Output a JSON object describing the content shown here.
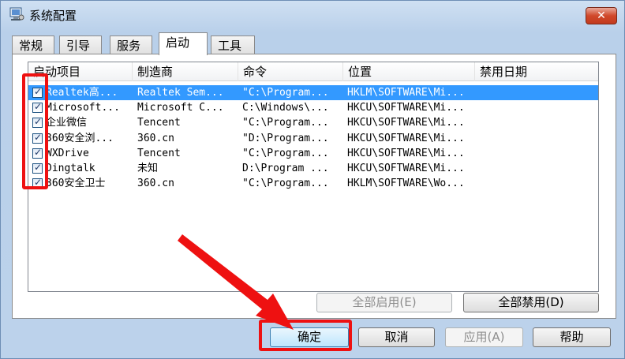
{
  "window": {
    "title": "系统配置",
    "close_label": "✕"
  },
  "tabs": [
    {
      "label": "常规",
      "active": false
    },
    {
      "label": "引导",
      "active": false
    },
    {
      "label": "服务",
      "active": false
    },
    {
      "label": "启动",
      "active": true
    },
    {
      "label": "工具",
      "active": false
    }
  ],
  "startup_list": {
    "columns": [
      "启动项目",
      "制造商",
      "命令",
      "位置",
      "禁用日期"
    ],
    "rows": [
      {
        "checked": true,
        "item": "Realtek高...",
        "maker": "Realtek Sem...",
        "command": "\"C:\\Program...",
        "location": "HKLM\\SOFTWARE\\Mi...",
        "disabled_date": "",
        "selected": true
      },
      {
        "checked": true,
        "item": "Microsoft...",
        "maker": "Microsoft C...",
        "command": "C:\\Windows\\...",
        "location": "HKCU\\SOFTWARE\\Mi...",
        "disabled_date": "",
        "selected": false
      },
      {
        "checked": true,
        "item": "企业微信",
        "maker": "Tencent",
        "command": "\"C:\\Program...",
        "location": "HKCU\\SOFTWARE\\Mi...",
        "disabled_date": "",
        "selected": false
      },
      {
        "checked": true,
        "item": "360安全浏...",
        "maker": "360.cn",
        "command": "\"D:\\Program...",
        "location": "HKCU\\SOFTWARE\\Mi...",
        "disabled_date": "",
        "selected": false
      },
      {
        "checked": true,
        "item": "WXDrive",
        "maker": "Tencent",
        "command": "\"C:\\Program...",
        "location": "HKCU\\SOFTWARE\\Mi...",
        "disabled_date": "",
        "selected": false
      },
      {
        "checked": true,
        "item": "Dingtalk",
        "maker": "未知",
        "command": "D:\\Program ...",
        "location": "HKCU\\SOFTWARE\\Mi...",
        "disabled_date": "",
        "selected": false
      },
      {
        "checked": true,
        "item": "360安全卫士",
        "maker": "360.cn",
        "command": "\"C:\\Program...",
        "location": "HKLM\\SOFTWARE\\Wo...",
        "disabled_date": "",
        "selected": false
      }
    ]
  },
  "panel_buttons": {
    "enable_all": "全部启用(E)",
    "disable_all": "全部禁用(D)"
  },
  "dialog_buttons": {
    "ok": "确定",
    "cancel": "取消",
    "apply": "应用(A)",
    "help": "帮助"
  },
  "colors": {
    "highlight": "#ee1111",
    "selection": "#3399ff"
  }
}
